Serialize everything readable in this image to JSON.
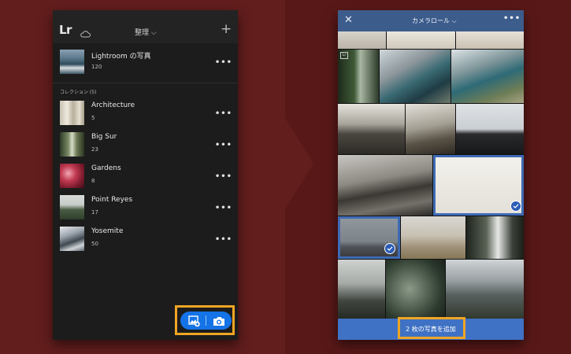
{
  "library_screen": {
    "logo": "Lr",
    "sort_label": "整理 ⌵",
    "add_symbol": "+",
    "all_photos": {
      "title": "Lightroom の写真",
      "count": "120"
    },
    "collections_label": "コレクション (5)",
    "collections": [
      {
        "title": "Architecture",
        "count": "5"
      },
      {
        "title": "Big Sur",
        "count": "23"
      },
      {
        "title": "Gardens",
        "count": "8"
      },
      {
        "title": "Point Reyes",
        "count": "17"
      },
      {
        "title": "Yosemite",
        "count": "50"
      }
    ],
    "more_symbol": "•••",
    "fab_color": "#1473e6"
  },
  "camera_roll_screen": {
    "close_symbol": "✕",
    "source_label": "カメラロール ⌵",
    "more_symbol": "•••",
    "lightroom_badge": "Lr",
    "add_button_label": "2 枚の写真を追加",
    "accent_color": "#3f72c4",
    "selected_photos": [
      "into-the-wild-card",
      "misty-field"
    ]
  },
  "highlight_color": "#f0a524"
}
